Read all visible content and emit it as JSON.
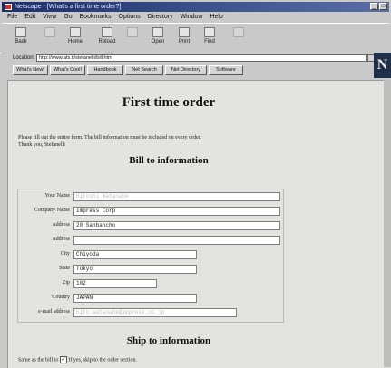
{
  "window": {
    "title": "Netscape - [What's a first time order?]"
  },
  "menu": [
    "File",
    "Edit",
    "View",
    "Go",
    "Bookmarks",
    "Options",
    "Directory",
    "Window",
    "Help"
  ],
  "toolbar": {
    "buttons": [
      {
        "label": "Back",
        "icon": "back-arrow-icon",
        "enabled": true
      },
      {
        "label": "",
        "icon": "forward-arrow-icon",
        "enabled": false
      },
      {
        "label": "Home",
        "icon": "home-icon",
        "enabled": true
      },
      {
        "label": "Reload",
        "icon": "reload-icon",
        "enabled": true
      },
      {
        "label": "",
        "icon": "images-icon",
        "enabled": false
      },
      {
        "label": "Open",
        "icon": "open-icon",
        "enabled": true
      },
      {
        "label": "Print",
        "icon": "print-icon",
        "enabled": true
      },
      {
        "label": "Find",
        "icon": "find-icon",
        "enabled": true
      },
      {
        "label": "",
        "icon": "stop-icon",
        "enabled": false
      }
    ]
  },
  "location": {
    "label": "Location:",
    "url": "http://www.ats.ti/stefanelli/bill.htm"
  },
  "directory_buttons": [
    "What's New!",
    "What's Cool!",
    "Handbook",
    "Net Search",
    "Net Directory",
    "Software"
  ],
  "page": {
    "title": "First time order",
    "intro_line1": "Please fill out the entire form. The bill information must be included on every order.",
    "intro_line2": "Thank you, Stefanelli",
    "bill_heading": "Bill to information",
    "ship_heading": "Ship to information",
    "same_as_bill_prefix": "Same as the bill to",
    "same_as_bill_checked": "✓",
    "same_as_bill_suffix": "If yes, skip to the order section."
  },
  "bill_form": [
    {
      "label": "Your Name",
      "value": "Hiroshi Watanabe"
    },
    {
      "label": "Company Name",
      "value": "Impress Corp"
    },
    {
      "label": "Address",
      "value": "20 Sanbancho"
    },
    {
      "label": "Address",
      "value": ""
    },
    {
      "label": "City",
      "value": "Chiyoda"
    },
    {
      "label": "State",
      "value": "Tokyo"
    },
    {
      "label": "Zip",
      "value": "102"
    },
    {
      "label": "Country",
      "value": "JAPAN"
    },
    {
      "label": "e-mail address",
      "value": "hiro.watanabe@impress.co.jp"
    }
  ],
  "colors": {
    "title_bar": "#1a2f6b",
    "page_background": "#e3e3e0",
    "chrome": "#c9c9c9"
  }
}
